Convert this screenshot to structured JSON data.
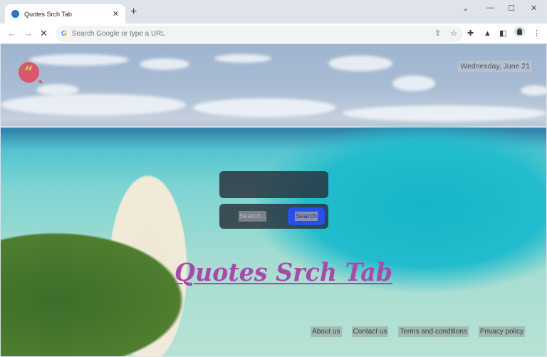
{
  "browser": {
    "tab": {
      "title": "Quotes Srch Tab",
      "favicon": "chrome-circle-icon",
      "close_glyph": "✕"
    },
    "new_tab_glyph": "+",
    "window_controls": {
      "dropdown": "⌄",
      "minimize": "—",
      "maximize": "☐",
      "close": "✕"
    },
    "nav": {
      "back": "←",
      "forward": "→",
      "stop": "✕"
    },
    "omnibox": {
      "placeholder": "Search Google or type a URL",
      "value": "",
      "google_glyph": "G"
    },
    "omnibox_icons": [
      "share-icon",
      "bookmark-star-icon"
    ],
    "toolbar_icons": [
      "extensions-puzzle-icon",
      "labs-flask-icon",
      "side-panel-icon",
      "profile-avatar-icon",
      "menu-kebab-icon"
    ]
  },
  "page": {
    "logo": {
      "glyph": "“",
      "icon": "quote-bubble-icon",
      "color": "#d85768",
      "glyph_color": "#c9d35c"
    },
    "date": "Wednesday, June 21",
    "quote_text": "",
    "search": {
      "placeholder": "Search...",
      "button_label": "Search",
      "button_color": "#2650e8"
    },
    "brand_title": "Quotes Srch Tab",
    "brand_color": "#a84aa8",
    "footer_links": [
      "About us",
      "Contact us",
      "Terms and conditions",
      "Privacy policy"
    ]
  }
}
